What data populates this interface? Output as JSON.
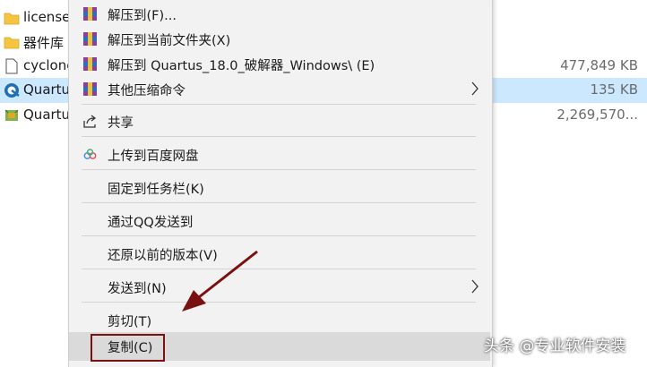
{
  "files": [
    {
      "name": "license",
      "size": "",
      "icon": "folder-icon"
    },
    {
      "name": "器件库",
      "size": "",
      "icon": "folder-icon"
    },
    {
      "name": "cyclone",
      "size": "477,849 KB",
      "icon": "file-icon"
    },
    {
      "name": "Quartu",
      "size": "135 KB",
      "icon": "quartus-icon",
      "selected": true
    },
    {
      "name": "Quartu",
      "size": "2,269,570...",
      "icon": "installer-icon"
    }
  ],
  "menu": {
    "extract_to": "解压到(F)...",
    "extract_here": "解压到当前文件夹(X)",
    "extract_named": "解压到 Quartus_18.0_破解器_Windows\\ (E)",
    "other_compress": "其他压缩命令",
    "share": "共享",
    "upload_baidu": "上传到百度网盘",
    "pin_taskbar": "固定到任务栏(K)",
    "send_qq": "通过QQ发送到",
    "restore_versions": "还原以前的版本(V)",
    "send_to": "发送到(N)",
    "cut": "剪切(T)",
    "copy": "复制(C)"
  },
  "watermark": "头条 @专业软件安装",
  "colors": {
    "menu_bg": "#f2f2f2",
    "selection": "#cce8ff",
    "hover": "#dadada",
    "annotation": "#7a1010"
  }
}
